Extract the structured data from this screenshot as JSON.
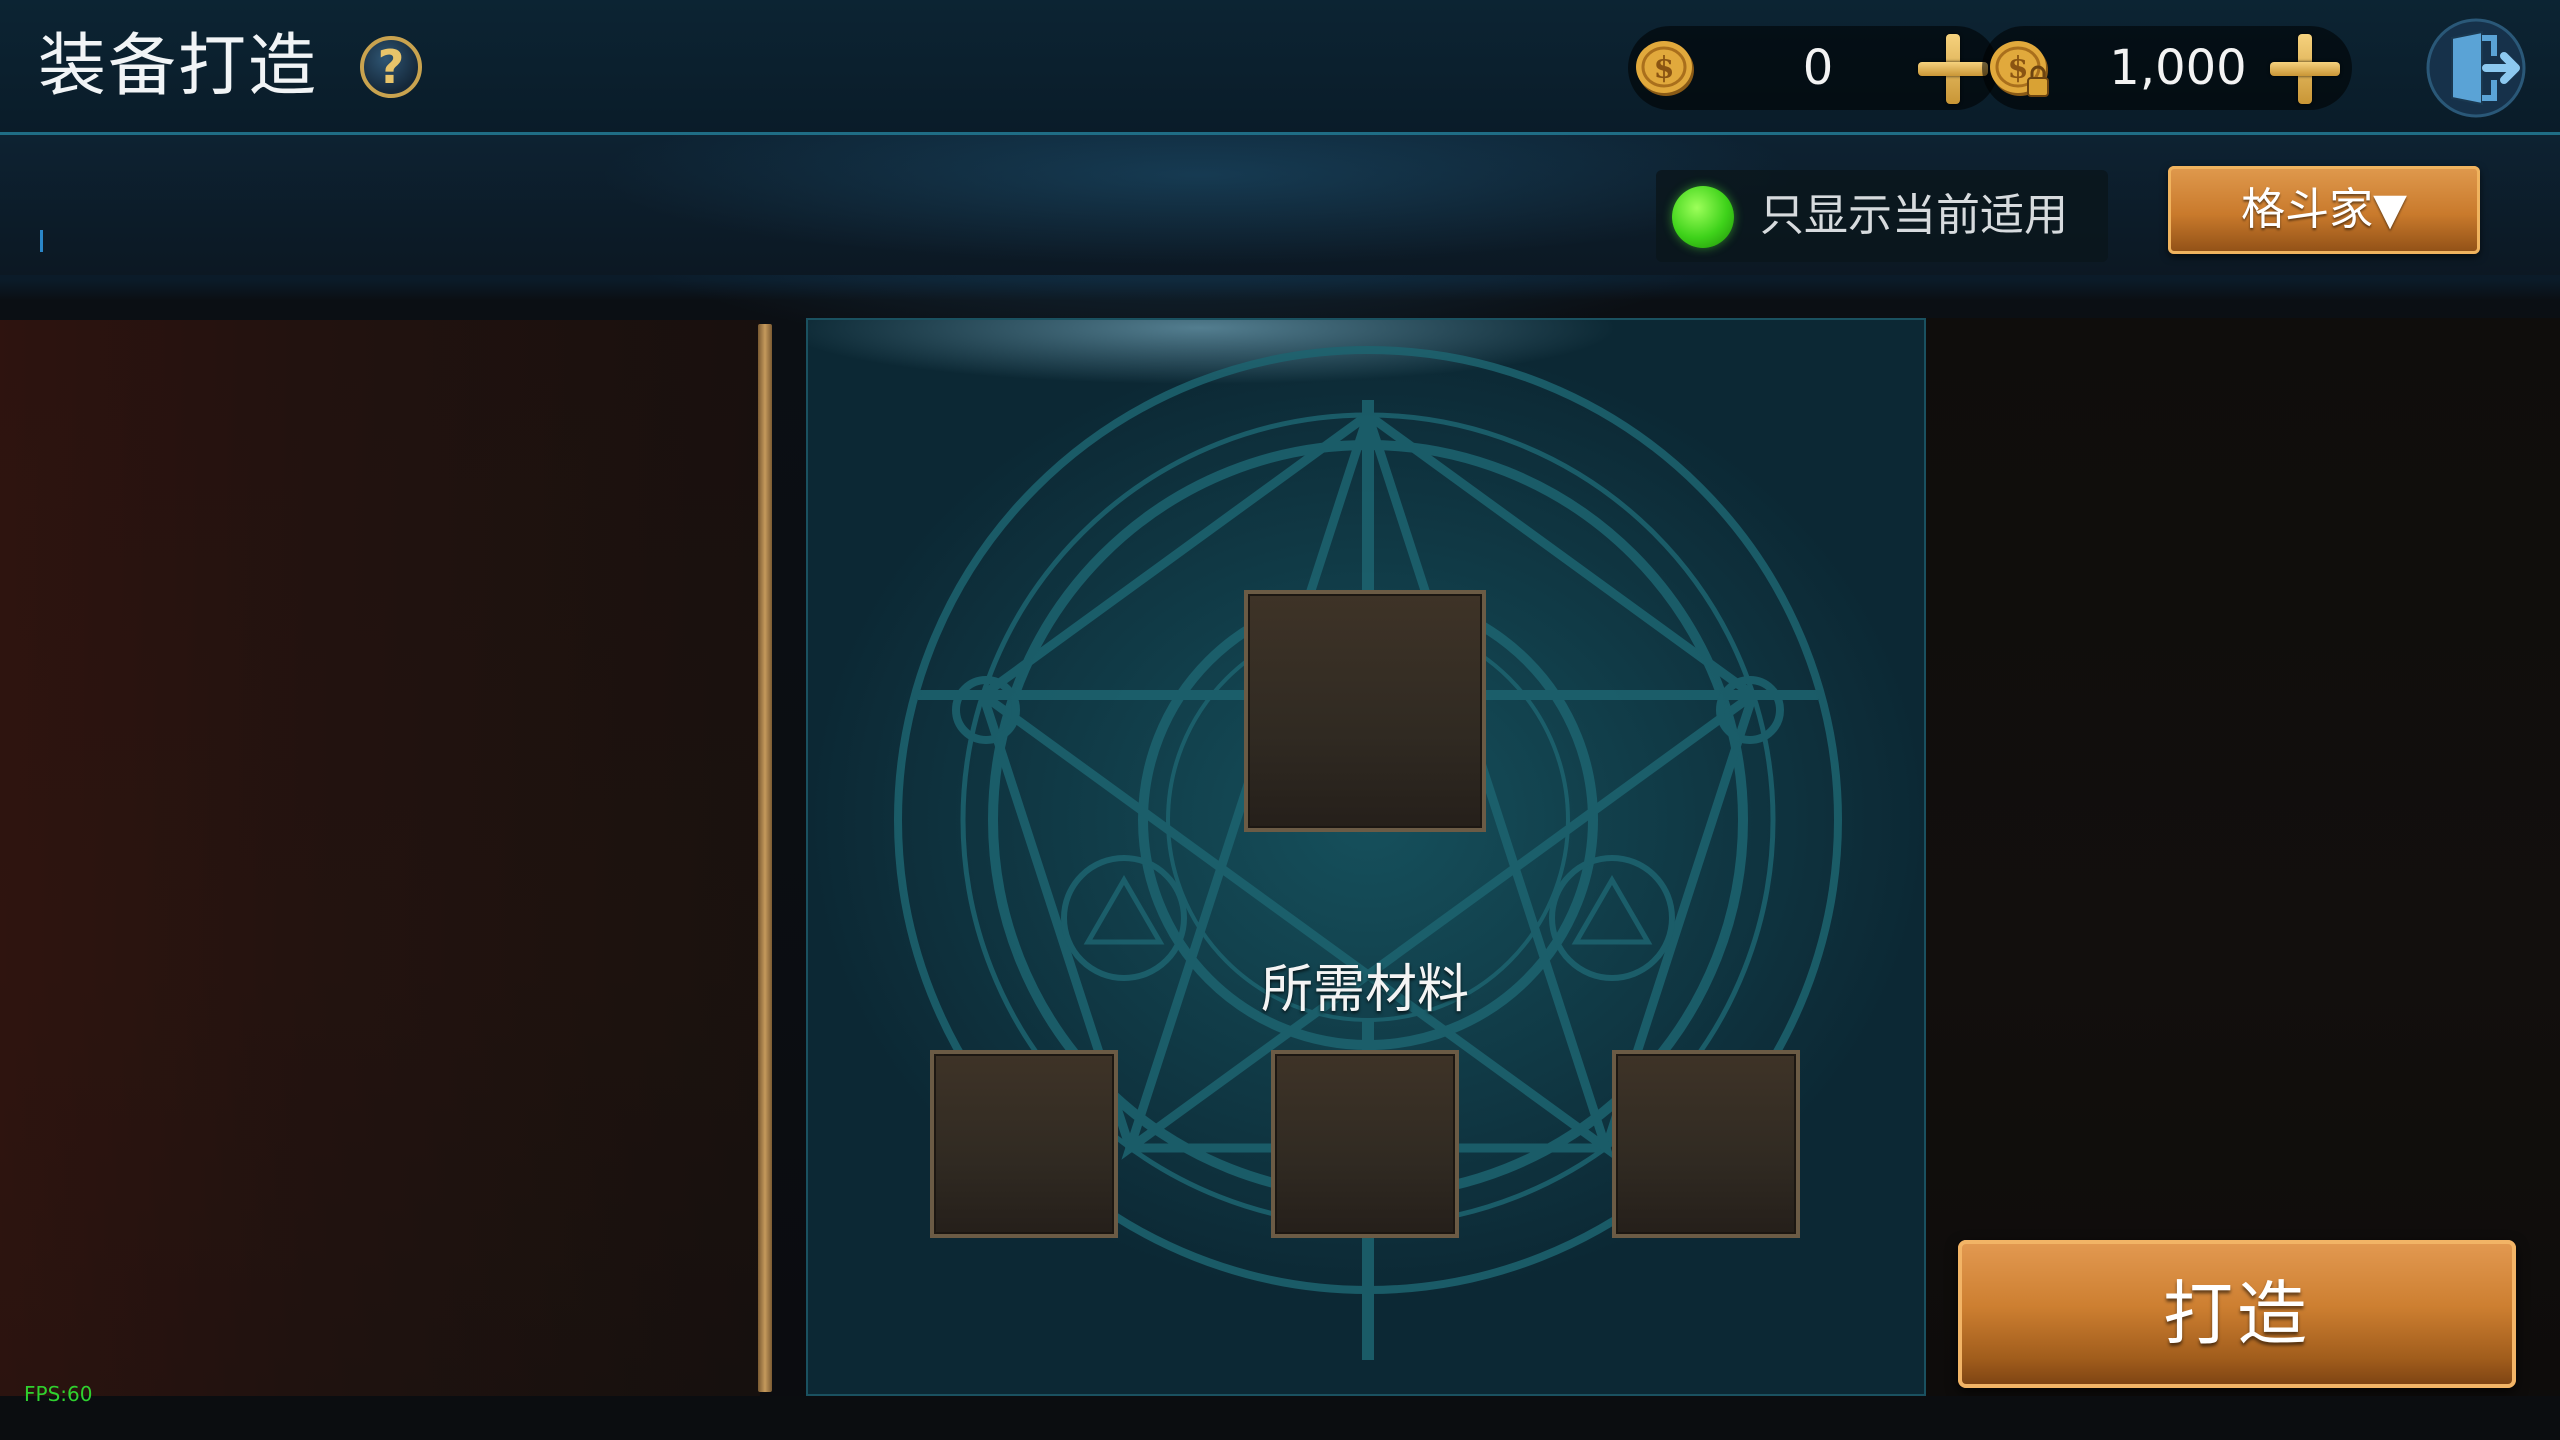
{
  "header": {
    "title": "装备打造",
    "help_icon_text": "?"
  },
  "currency": [
    {
      "name": "gold-coin",
      "value": "0"
    },
    {
      "name": "locked-gold-coin",
      "value": "1,000"
    }
  ],
  "filter": {
    "toggle_label": "只显示当前适用",
    "toggle_on": true,
    "class_dropdown_label": "格斗家▼"
  },
  "crafting": {
    "materials_label": "所需材料"
  },
  "actions": {
    "craft_button_label": "打造"
  },
  "debug": {
    "fps_text": "FPS:60"
  },
  "colors": {
    "toggle_on": "#3ed21a",
    "button_orange": "#cd7f31",
    "accent_teal": "#1f6d85"
  }
}
